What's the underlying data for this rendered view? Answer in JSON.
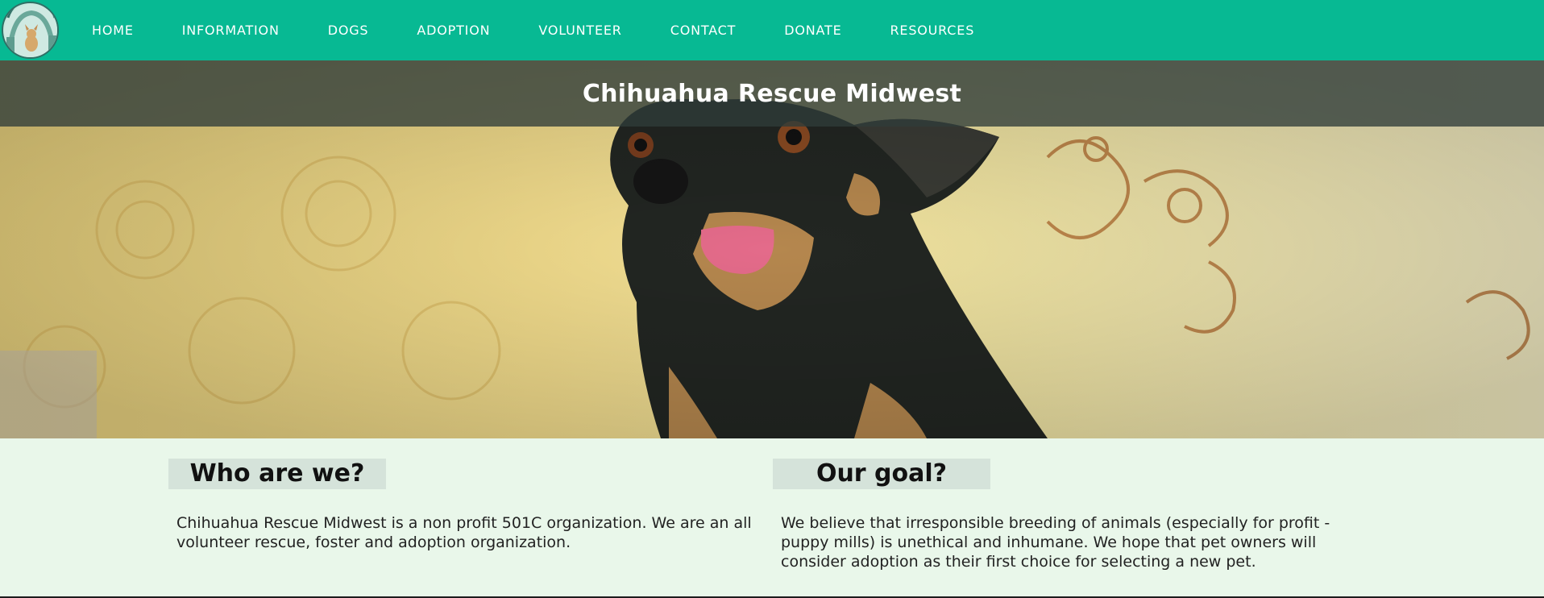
{
  "brand": {
    "logo_label": "CHIHUAHUA RESCUE MIDWEST",
    "accent_color": "#07b993"
  },
  "nav": {
    "items": [
      {
        "label": "HOME"
      },
      {
        "label": "INFORMATION"
      },
      {
        "label": "DOGS"
      },
      {
        "label": "ADOPTION"
      },
      {
        "label": "VOLUNTEER"
      },
      {
        "label": "CONTACT"
      },
      {
        "label": "DONATE"
      },
      {
        "label": "RESOURCES"
      }
    ]
  },
  "hero": {
    "title": "Chihuahua Rescue Midwest"
  },
  "sections": {
    "who": {
      "heading": "Who are we?",
      "body": "Chihuahua Rescue Midwest is a non profit 501C organization. We are an all volunteer rescue, foster and adoption organization."
    },
    "goal": {
      "heading": "Our goal?",
      "body": "We believe that irresponsible breeding of animals (especially for profit - puppy mills) is unethical and inhumane. We hope that pet owners will consider adoption as their first choice for selecting a new pet."
    }
  }
}
